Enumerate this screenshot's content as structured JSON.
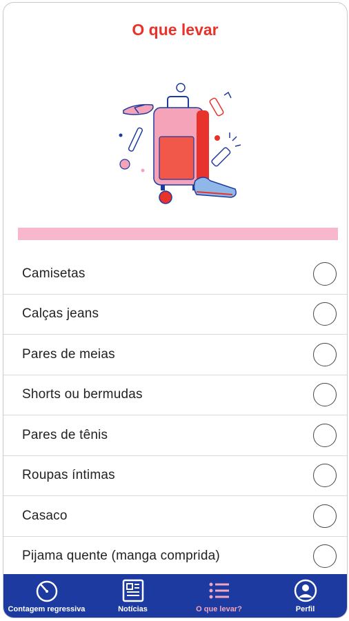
{
  "header": {
    "title": "O que levar"
  },
  "colors": {
    "accent": "#e8322c",
    "pink": "#f7b7cd",
    "nav_bg": "#1d3aa0",
    "nav_active": "#f2a6c0"
  },
  "checklist": [
    {
      "label": "Camisetas",
      "checked": false
    },
    {
      "label": "Calças jeans",
      "checked": false
    },
    {
      "label": "Pares de meias",
      "checked": false
    },
    {
      "label": "Shorts ou bermudas",
      "checked": false
    },
    {
      "label": "Pares de tênis",
      "checked": false
    },
    {
      "label": "Roupas íntimas",
      "checked": false
    },
    {
      "label": "Casaco",
      "checked": false
    },
    {
      "label": "Pijama quente (manga comprida)",
      "checked": false
    }
  ],
  "nav": {
    "items": [
      {
        "label": "Contagem regressiva",
        "icon": "timer-icon"
      },
      {
        "label": "Notícias",
        "icon": "newspaper-icon"
      },
      {
        "label": "O que levar?",
        "icon": "list-icon",
        "active": true
      },
      {
        "label": "Perfil",
        "icon": "profile-icon"
      }
    ]
  }
}
